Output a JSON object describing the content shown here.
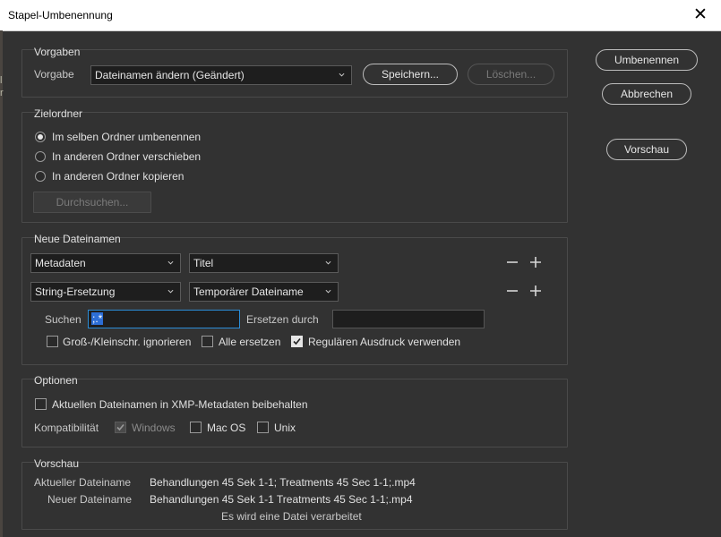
{
  "window": {
    "title": "Stapel-Umbenennung",
    "close_icon": "close-icon"
  },
  "side_buttons": {
    "rename": "Umbenennen",
    "cancel": "Abbrechen",
    "preview": "Vorschau"
  },
  "presets": {
    "heading": "Vorgaben",
    "label": "Vorgabe",
    "selected": "Dateinamen ändern (Geändert)",
    "save": "Speichern...",
    "delete": "Löschen..."
  },
  "destination": {
    "heading": "Zielordner",
    "options": [
      "Im selben Ordner umbenennen",
      "In anderen Ordner verschieben",
      "In anderen Ordner kopieren"
    ],
    "selected_index": 0,
    "browse": "Durchsuchen..."
  },
  "new_filenames": {
    "heading": "Neue Dateinamen",
    "rows": [
      {
        "type": "Metadaten",
        "value": "Titel"
      },
      {
        "type": "String-Ersetzung",
        "value": "Temporärer Dateiname"
      }
    ],
    "search_label": "Suchen",
    "search_value": ";.*",
    "replace_label": "Ersetzen durch",
    "replace_value": "",
    "ignore_case": "Groß-/Kleinschr. ignorieren",
    "ignore_case_checked": false,
    "replace_all": "Alle ersetzen",
    "replace_all_checked": false,
    "use_regex": "Regulären Ausdruck verwenden",
    "use_regex_checked": true
  },
  "options": {
    "heading": "Optionen",
    "keep_xmp": "Aktuellen Dateinamen in XMP-Metadaten beibehalten",
    "keep_xmp_checked": false,
    "compat_label": "Kompatibilität",
    "windows": "Windows",
    "windows_checked": true,
    "macos": "Mac OS",
    "macos_checked": false,
    "unix": "Unix",
    "unix_checked": false
  },
  "preview": {
    "heading": "Vorschau",
    "current_label": "Aktueller Dateiname",
    "current_value": "Behandlungen 45 Sek 1-1;  Treatments 45 Sec 1-1;.mp4",
    "new_label": "Neuer Dateiname",
    "new_value": "Behandlungen 45 Sek 1-1 Treatments 45 Sec 1-1;.mp4",
    "status": "Es wird eine Datei verarbeitet"
  },
  "colors": {
    "background": "#323232",
    "accent": "#2b8cd6",
    "selection": "#2d6ed6"
  }
}
